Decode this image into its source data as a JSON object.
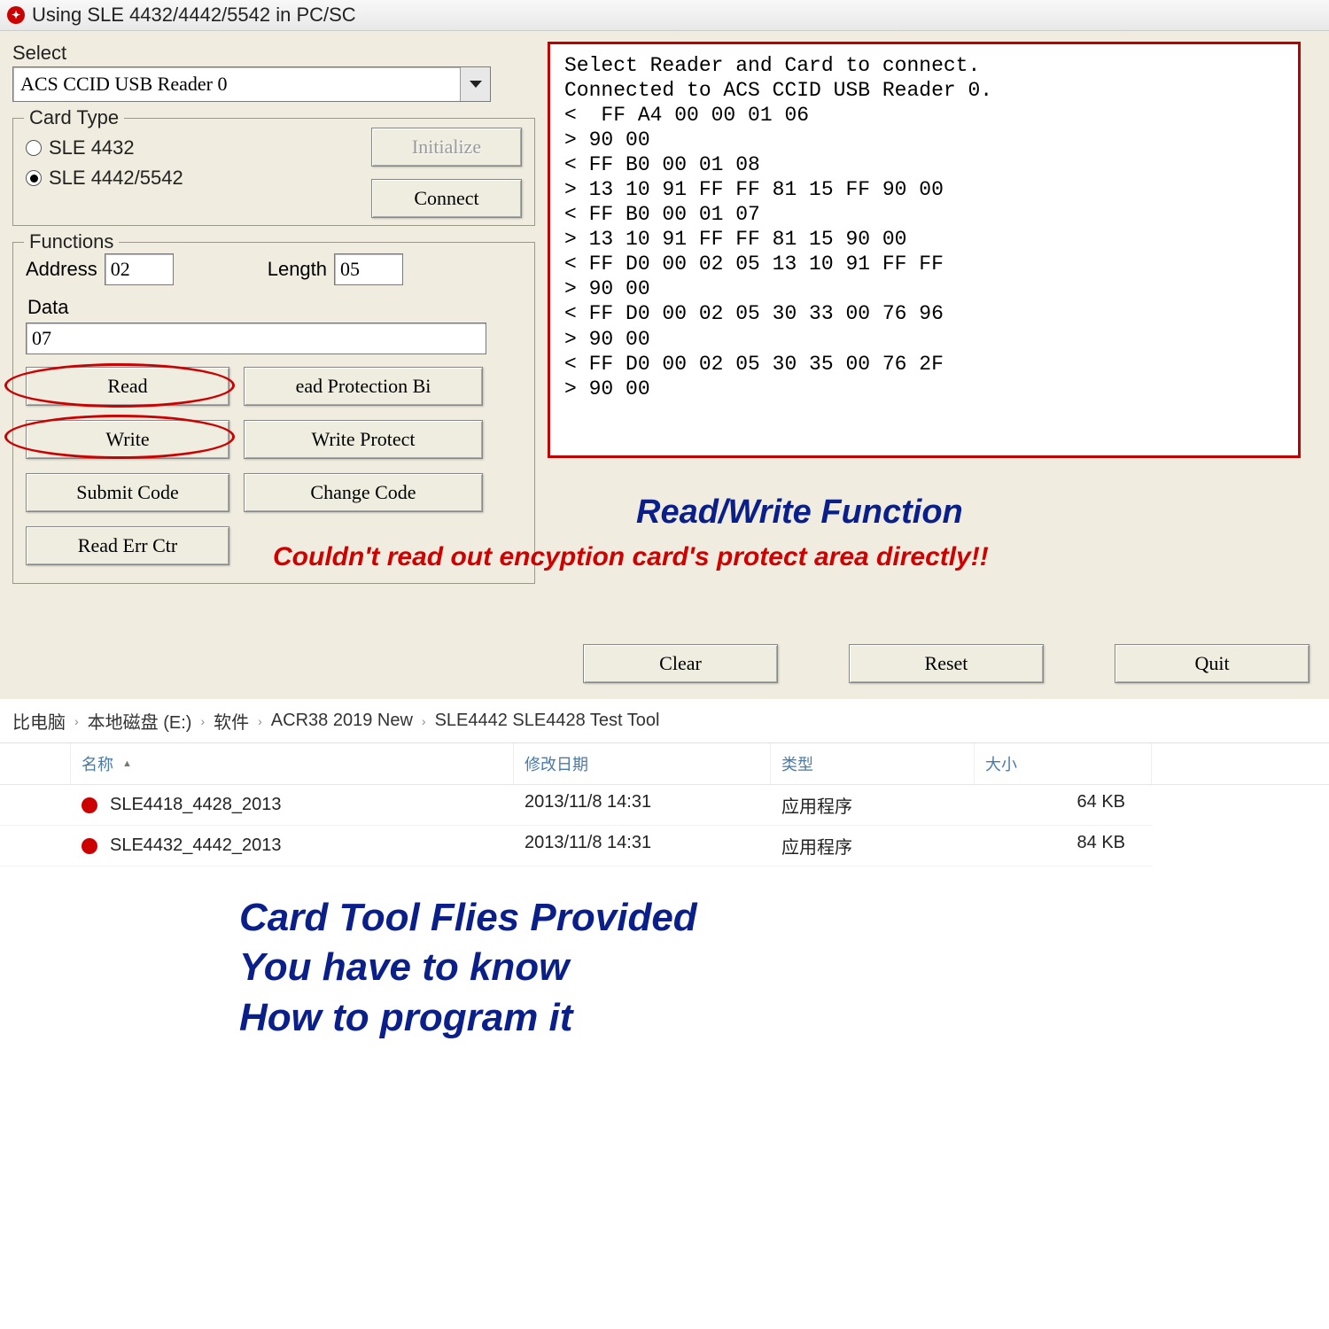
{
  "window": {
    "title": "Using SLE 4432/4442/5542 in PC/SC"
  },
  "select": {
    "label": "Select",
    "value": "ACS CCID USB Reader 0"
  },
  "card_type": {
    "legend": "Card Type",
    "opt1": "SLE 4432",
    "opt2": "SLE 4442/5542",
    "selected": "SLE 4442/5542",
    "initialize_btn": "Initialize",
    "connect_btn": "Connect"
  },
  "functions": {
    "legend": "Functions",
    "address_label": "Address",
    "address_value": "02",
    "length_label": "Length",
    "length_value": "05",
    "data_label": "Data",
    "data_value": "07",
    "btn_read": "Read",
    "btn_read_prot": "ead Protection Bi",
    "btn_write": "Write",
    "btn_write_prot": "Write Protect",
    "btn_submit": "Submit Code",
    "btn_change": "Change Code",
    "btn_read_err": "Read Err Ctr"
  },
  "bottom": {
    "clear": "Clear",
    "reset": "Reset",
    "quit": "Quit"
  },
  "log": "Select Reader and Card to connect.\nConnected to ACS CCID USB Reader 0.\n<  FF A4 00 00 01 06\n> 90 00\n< FF B0 00 01 08\n> 13 10 91 FF FF 81 15 FF 90 00\n< FF B0 00 01 07\n> 13 10 91 FF FF 81 15 90 00\n< FF D0 00 02 05 13 10 91 FF FF\n> 90 00\n< FF D0 00 02 05 30 33 00 76 96\n> 90 00\n< FF D0 00 02 05 30 35 00 76 2F\n> 90 00",
  "annotations": {
    "a1": "Read/Write Function",
    "a2": "Couldn't read out encyption card's protect area directly!!",
    "a3_l1": "Card Tool Flies Provided",
    "a3_l2": "You have to know",
    "a3_l3": "How to program it"
  },
  "explorer": {
    "breadcrumbs": [
      "比电脑",
      "本地磁盘 (E:)",
      "软件",
      "ACR38 2019 New",
      "SLE4442 SLE4428 Test Tool"
    ],
    "cols": {
      "name": "名称",
      "date": "修改日期",
      "type": "类型",
      "size": "大小"
    },
    "rows": [
      {
        "name": "SLE4418_4428_2013",
        "date": "2013/11/8 14:31",
        "type": "应用程序",
        "size": "64 KB"
      },
      {
        "name": "SLE4432_4442_2013",
        "date": "2013/11/8 14:31",
        "type": "应用程序",
        "size": "84 KB"
      }
    ]
  }
}
